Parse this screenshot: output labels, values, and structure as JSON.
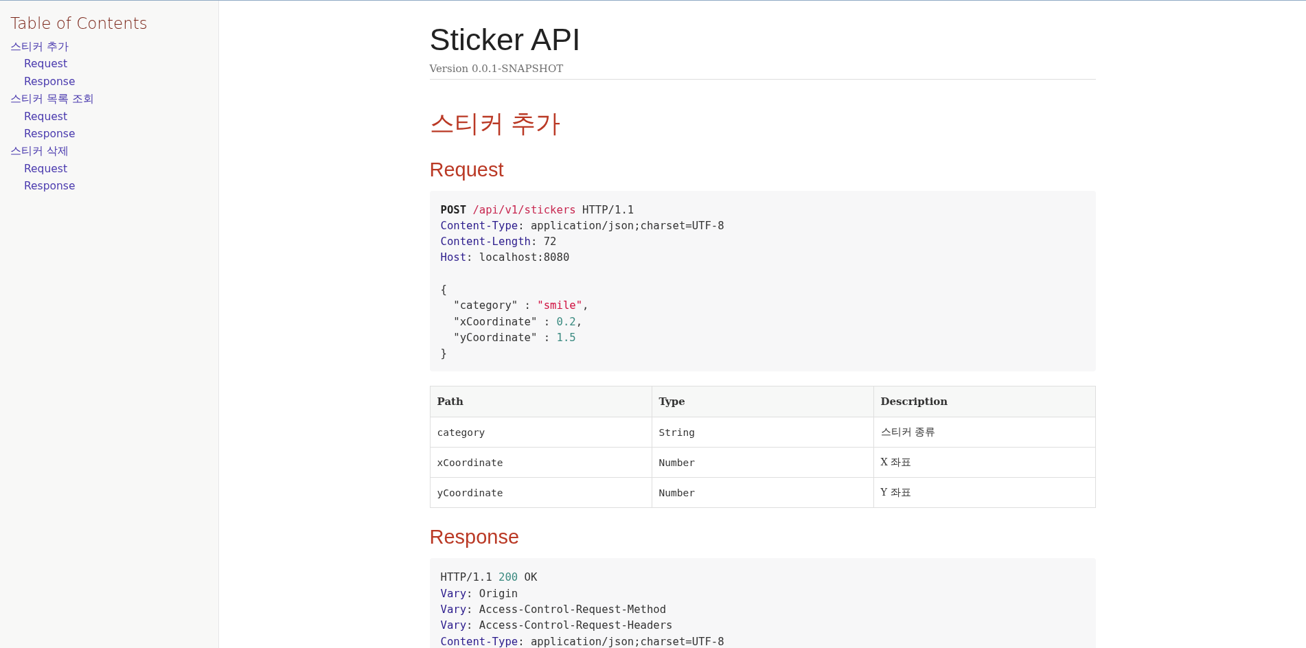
{
  "toc": {
    "title": "Table of Contents",
    "items": [
      {
        "label": "스티커 추가",
        "children": [
          {
            "label": "Request"
          },
          {
            "label": "Response"
          }
        ]
      },
      {
        "label": "스티커 목록 조회",
        "children": [
          {
            "label": "Request"
          },
          {
            "label": "Response"
          }
        ]
      },
      {
        "label": "스티커 삭제",
        "children": [
          {
            "label": "Request"
          },
          {
            "label": "Response"
          }
        ]
      }
    ]
  },
  "header": {
    "title": "Sticker API",
    "version": "Version 0.0.1-SNAPSHOT"
  },
  "sections": [
    {
      "title": "스티커 추가",
      "parts": [
        {
          "title": "Request",
          "code": [
            [
              [
                {
                  "kind": "method",
                  "text": "POST"
                },
                {
                  "kind": "path",
                  "text": " /api/v1/stickers"
                },
                {
                  "kind": "plain",
                  "text": " HTTP/1.1"
                }
              ],
              [
                {
                  "kind": "header",
                  "text": "Content-Type"
                },
                {
                  "kind": "plain",
                  "text": ": application/json;charset=UTF-8"
                }
              ],
              [
                {
                  "kind": "header",
                  "text": "Content-Length"
                },
                {
                  "kind": "plain",
                  "text": ": 72"
                }
              ],
              [
                {
                  "kind": "header",
                  "text": "Host"
                },
                {
                  "kind": "plain",
                  "text": ": localhost:8080"
                }
              ]
            ],
            [
              [
                {
                  "kind": "plain",
                  "text": "{"
                }
              ],
              [
                {
                  "kind": "plain",
                  "text": "  \"category\" : "
                },
                {
                  "kind": "string",
                  "text": "\"smile\""
                },
                {
                  "kind": "plain",
                  "text": ","
                }
              ],
              [
                {
                  "kind": "plain",
                  "text": "  \"xCoordinate\" : "
                },
                {
                  "kind": "number",
                  "text": "0.2"
                },
                {
                  "kind": "plain",
                  "text": ","
                }
              ],
              [
                {
                  "kind": "plain",
                  "text": "  \"yCoordinate\" : "
                },
                {
                  "kind": "number",
                  "text": "1.5"
                }
              ],
              [
                {
                  "kind": "plain",
                  "text": "}"
                }
              ]
            ]
          ],
          "table": {
            "columns": [
              "Path",
              "Type",
              "Description"
            ],
            "rows": [
              [
                "category",
                "String",
                "스티커 종류"
              ],
              [
                "xCoordinate",
                "Number",
                "X 좌표"
              ],
              [
                "yCoordinate",
                "Number",
                "Y 좌표"
              ]
            ]
          }
        },
        {
          "title": "Response",
          "code": [
            [
              [
                {
                  "kind": "plain",
                  "text": "HTTP/1.1 "
                },
                {
                  "kind": "number",
                  "text": "200"
                },
                {
                  "kind": "plain",
                  "text": " OK"
                }
              ],
              [
                {
                  "kind": "header",
                  "text": "Vary"
                },
                {
                  "kind": "plain",
                  "text": ": Origin"
                }
              ],
              [
                {
                  "kind": "header",
                  "text": "Vary"
                },
                {
                  "kind": "plain",
                  "text": ": Access-Control-Request-Method"
                }
              ],
              [
                {
                  "kind": "header",
                  "text": "Vary"
                },
                {
                  "kind": "plain",
                  "text": ": Access-Control-Request-Headers"
                }
              ],
              [
                {
                  "kind": "header",
                  "text": "Content-Type"
                },
                {
                  "kind": "plain",
                  "text": ": application/json;charset=UTF-8"
                }
              ]
            ]
          ]
        }
      ]
    }
  ]
}
